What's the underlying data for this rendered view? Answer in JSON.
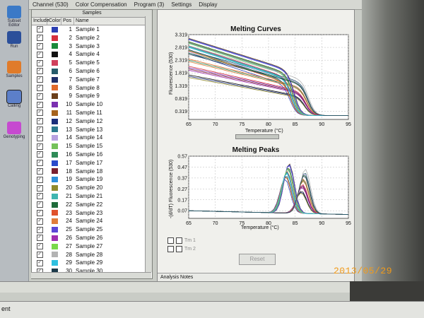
{
  "menubar": {
    "items": [
      "Channel (530)",
      "Color Compensation",
      "Program (3)",
      "Settings",
      "Display"
    ]
  },
  "sidebar": {
    "items": [
      {
        "label": "Subset Editor",
        "icon": "subset-editor-icon",
        "color": "#3b79c7"
      },
      {
        "label": "Run",
        "icon": "run-icon",
        "color": "#2b4f9a"
      },
      {
        "label": "Samples",
        "icon": "samples-icon",
        "color": "#e07b2a"
      },
      {
        "label": "Calling",
        "icon": "calling-icon",
        "color": "#5c7fc9"
      },
      {
        "label": "Genotyping",
        "icon": "genotyping-icon",
        "color": "#c64ad0"
      }
    ]
  },
  "samples_panel": {
    "title": "Samples",
    "columns": [
      "Include",
      "Color",
      "Pos",
      "Name"
    ],
    "rows": [
      {
        "pos": "1",
        "name": "Sample 1",
        "color": "#2c3fb2"
      },
      {
        "pos": "2",
        "name": "Sample 2",
        "color": "#d5303e"
      },
      {
        "pos": "3",
        "name": "Sample 3",
        "color": "#1a8a3a"
      },
      {
        "pos": "4",
        "name": "Sample 4",
        "color": "#111111"
      },
      {
        "pos": "5",
        "name": "Sample 5",
        "color": "#d0405c"
      },
      {
        "pos": "6",
        "name": "Sample 6",
        "color": "#275c6b"
      },
      {
        "pos": "7",
        "name": "Sample 7",
        "color": "#1f2f6a"
      },
      {
        "pos": "8",
        "name": "Sample 8",
        "color": "#e06a2c"
      },
      {
        "pos": "9",
        "name": "Sample 9",
        "color": "#6b3f1a"
      },
      {
        "pos": "10",
        "name": "Sample 10",
        "color": "#7a2fb0"
      },
      {
        "pos": "11",
        "name": "Sample 11",
        "color": "#a6631d"
      },
      {
        "pos": "12",
        "name": "Sample 12",
        "color": "#1b2e7a"
      },
      {
        "pos": "13",
        "name": "Sample 13",
        "color": "#2c7a8e"
      },
      {
        "pos": "14",
        "name": "Sample 14",
        "color": "#b8a1e0"
      },
      {
        "pos": "15",
        "name": "Sample 15",
        "color": "#74c25a"
      },
      {
        "pos": "16",
        "name": "Sample 16",
        "color": "#2e8b57"
      },
      {
        "pos": "17",
        "name": "Sample 17",
        "color": "#2a4acb"
      },
      {
        "pos": "18",
        "name": "Sample 18",
        "color": "#7a1f2f"
      },
      {
        "pos": "19",
        "name": "Sample 19",
        "color": "#2f8fd9"
      },
      {
        "pos": "20",
        "name": "Sample 20",
        "color": "#8f8a2c"
      },
      {
        "pos": "21",
        "name": "Sample 21",
        "color": "#3fb6b0"
      },
      {
        "pos": "22",
        "name": "Sample 22",
        "color": "#1f6b3a"
      },
      {
        "pos": "23",
        "name": "Sample 23",
        "color": "#e0522c"
      },
      {
        "pos": "24",
        "name": "Sample 24",
        "color": "#e07d3a"
      },
      {
        "pos": "25",
        "name": "Sample 25",
        "color": "#5b47d6"
      },
      {
        "pos": "26",
        "name": "Sample 26",
        "color": "#a02fb0"
      },
      {
        "pos": "27",
        "name": "Sample 27",
        "color": "#7ad94a"
      },
      {
        "pos": "28",
        "name": "Sample 28",
        "color": "#b3b3b3"
      },
      {
        "pos": "29",
        "name": "Sample 29",
        "color": "#2fc0e0"
      },
      {
        "pos": "30",
        "name": "Sample 30",
        "color": "#1c3a4a"
      }
    ]
  },
  "analysis": {
    "legend_items": [
      "Tm 1",
      "Tm 2"
    ],
    "reset_label": "Reset",
    "notes_label": "Analysis Notes"
  },
  "statusbar": {
    "text": "ent"
  },
  "date_stamp": "2013/05/29",
  "chart_data": [
    {
      "type": "line",
      "title": "Melting Curves",
      "xlabel": "Temperature (°C)",
      "ylabel": "Fluorescence (530)",
      "xlim": [
        65,
        95
      ],
      "ylim": [
        0,
        3.319
      ],
      "x_ticks": [
        "65",
        "70",
        "75",
        "80",
        "85",
        "90",
        "95"
      ],
      "x_tick_values": [
        65,
        70,
        75,
        80,
        85,
        90,
        95
      ],
      "y_ticks": [
        "0.319",
        "0.819",
        "1.319",
        "1.819",
        "2.319",
        "2.819",
        "3.319"
      ],
      "y_tick_values": [
        0.319,
        0.819,
        1.319,
        1.819,
        2.319,
        2.819,
        3.319
      ],
      "grid": true,
      "series_group_a": {
        "start_range": [
          2.6,
          3.2
        ],
        "end_before_drop_range": [
          1.3,
          1.9
        ],
        "drop_temperature": 84.5,
        "end_value": 0.15
      },
      "series_group_b": {
        "start_range": [
          1.6,
          2.9
        ],
        "end_before_drop_range": [
          0.8,
          1.5
        ],
        "drop_temperature": 87.2,
        "end_value": 0.15
      }
    },
    {
      "type": "line",
      "title": "Melting Peaks",
      "xlabel": "Temperature (°C)",
      "ylabel": "-(d/dT) Fluorescence (530)",
      "xlim": [
        65,
        95
      ],
      "ylim": [
        0,
        0.57
      ],
      "x_ticks": [
        "65",
        "70",
        "75",
        "80",
        "85",
        "90",
        "95"
      ],
      "x_tick_values": [
        65,
        70,
        75,
        80,
        85,
        90,
        95
      ],
      "y_ticks": [
        "0.07",
        "0.17",
        "0.27",
        "0.37",
        "0.47",
        "0.57"
      ],
      "y_tick_values": [
        0.07,
        0.17,
        0.27,
        0.37,
        0.47,
        0.57
      ],
      "grid": true,
      "series_group_a": {
        "peak_temperature": 83.5,
        "peak_range": [
          0.38,
          0.53
        ]
      },
      "series_group_b": {
        "peak_temperature": 86.5,
        "peak_range": [
          0.25,
          0.48
        ]
      },
      "baseline": 0.07
    }
  ]
}
